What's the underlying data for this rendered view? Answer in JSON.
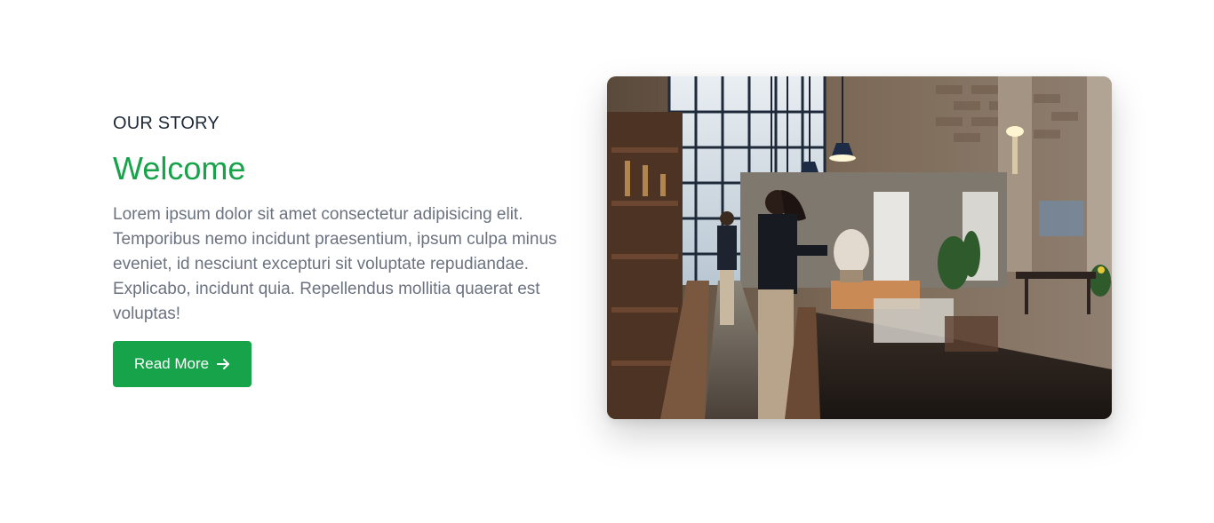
{
  "story": {
    "eyebrow": "OUR STORY",
    "title": "Welcome",
    "body": "Lorem ipsum dolor sit amet consectetur adipisicing elit. Temporibus nemo incidunt praesentium, ipsum culpa minus eveniet, id nesciunt excepturi sit voluptate repudiandae. Explicabo, incidunt quia. Repellendus mollitia quaerat est voluptas!",
    "button_label": "Read More",
    "button_icon": "arrow-right-icon"
  },
  "image": {
    "subject": "cafe-interior-photo"
  },
  "colors": {
    "accent": "#16a34a",
    "heading": "#1f2937",
    "body": "#6b7280"
  }
}
